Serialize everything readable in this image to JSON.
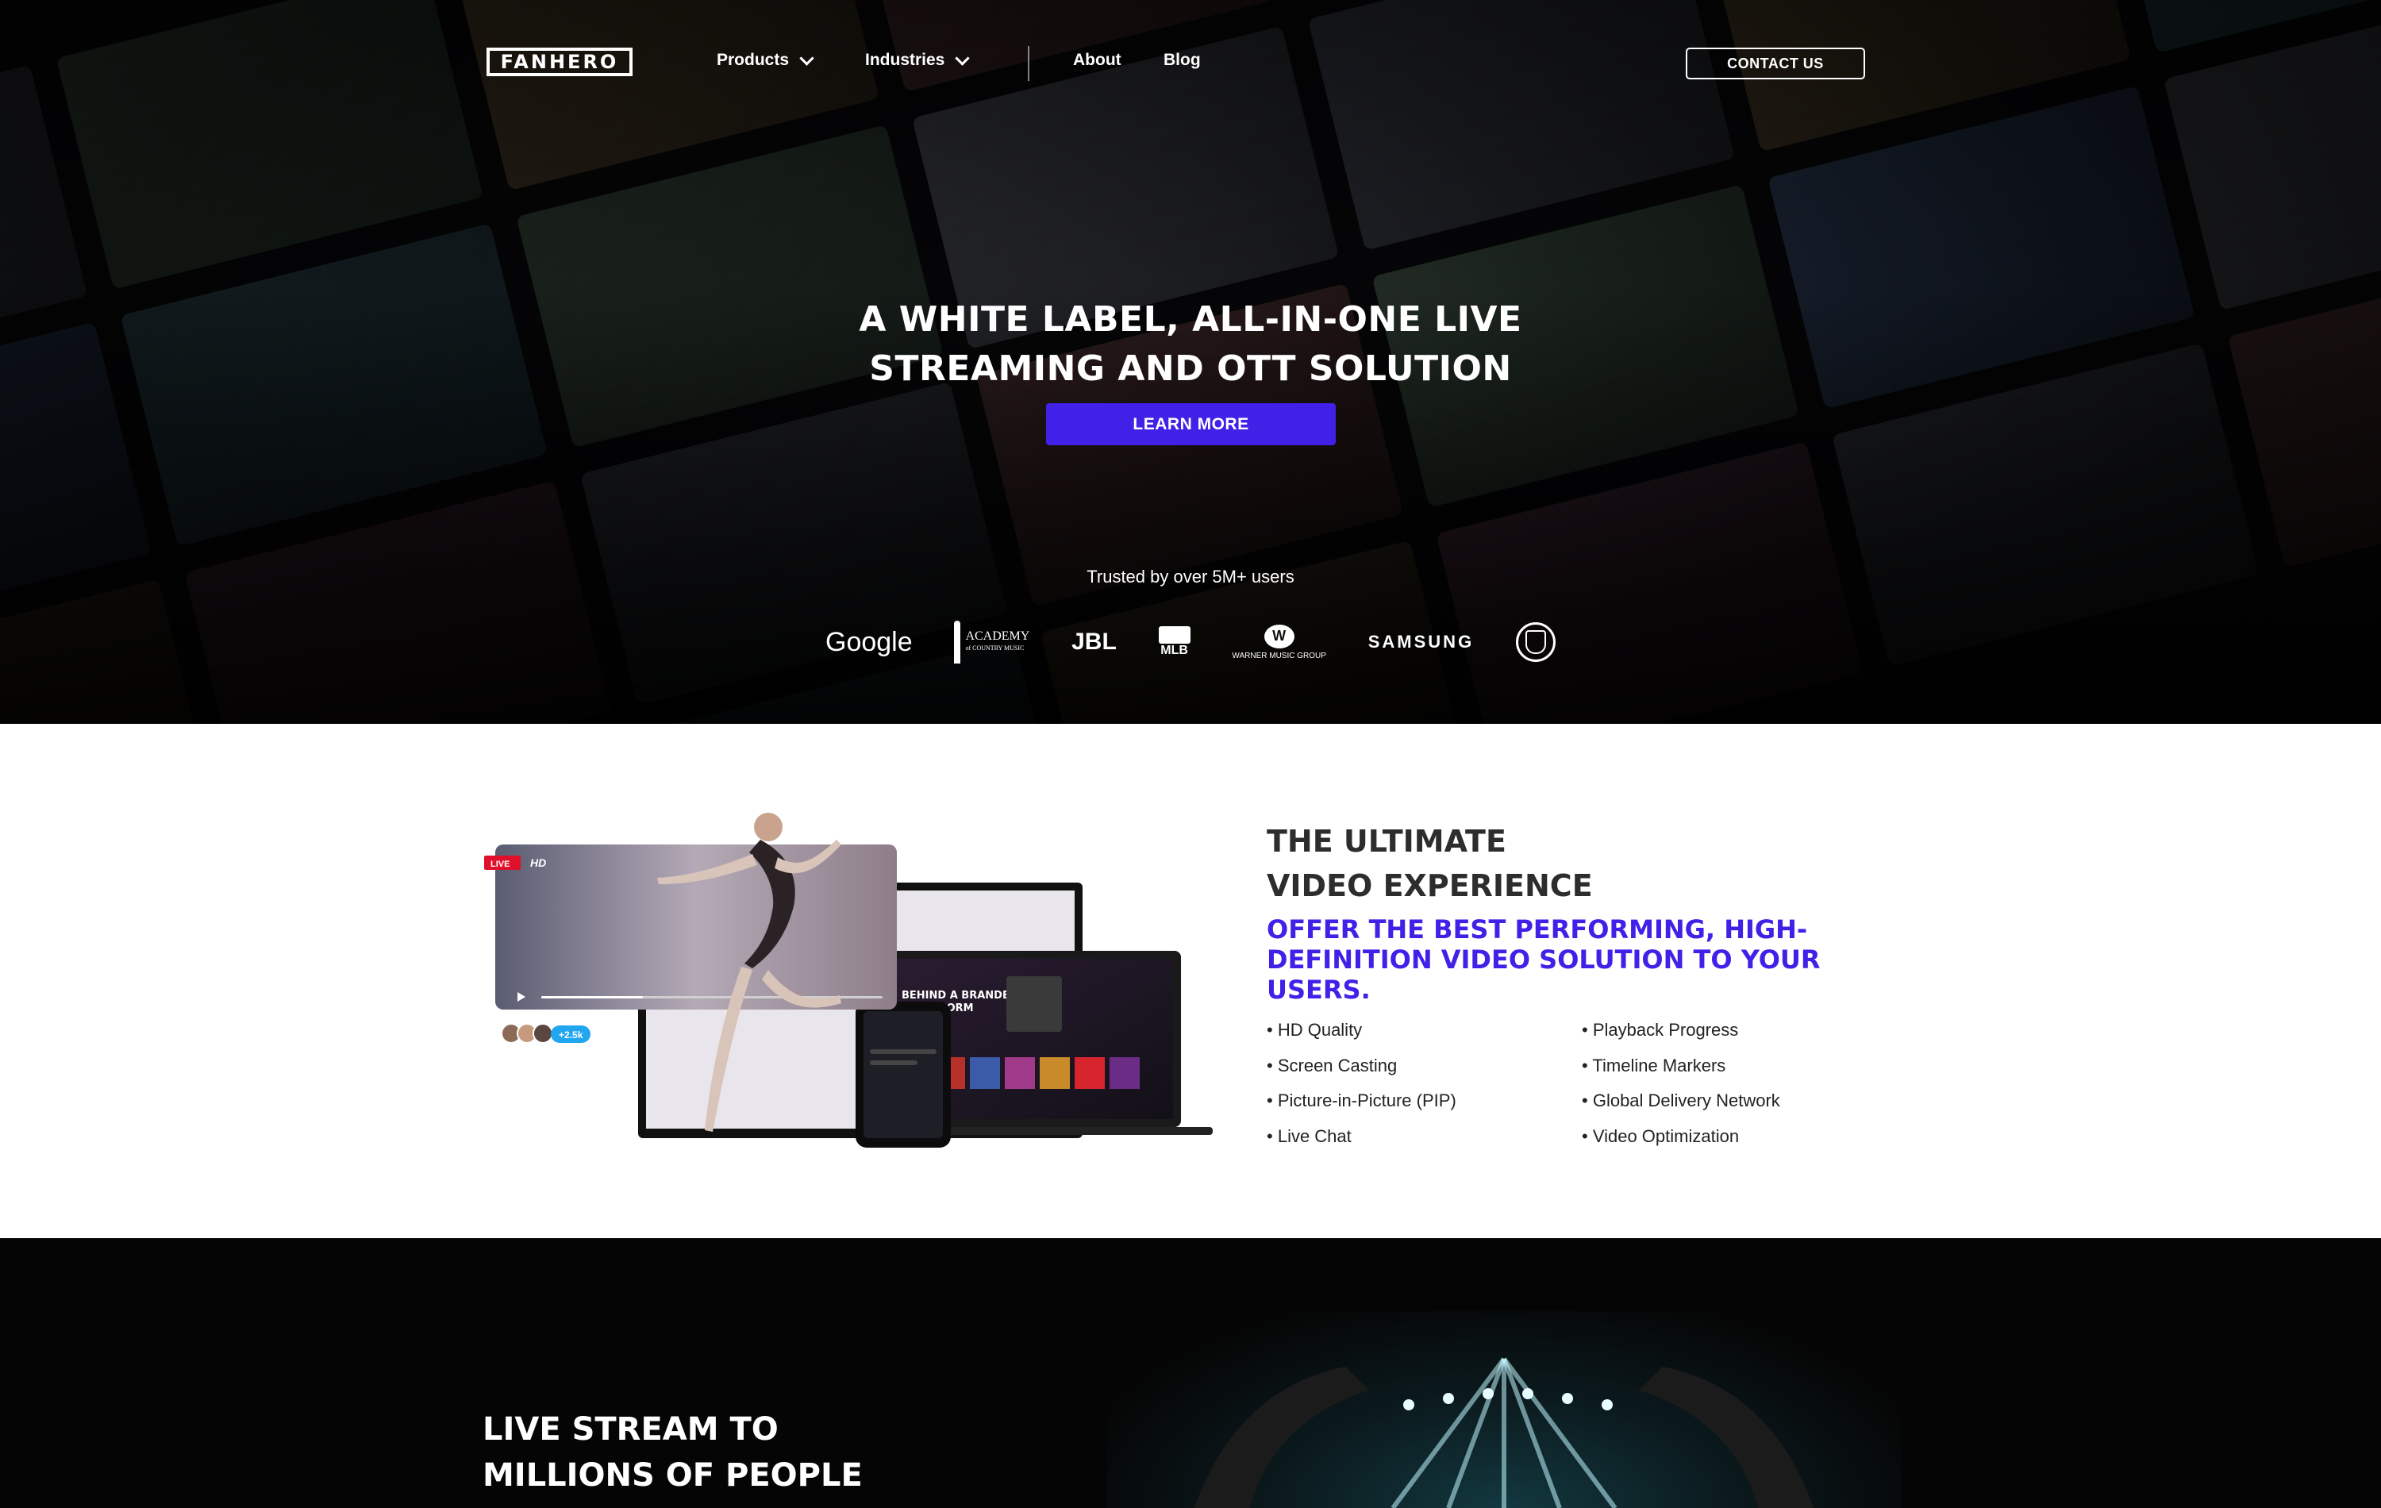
{
  "nav": {
    "logo": "FANHERO",
    "products": "Products",
    "industries": "Industries",
    "about": "About",
    "blog": "Blog",
    "contact": "CONTACT US"
  },
  "hero": {
    "title_line1": "A WHITE LABEL, ALL-IN-ONE LIVE",
    "title_line2": "STREAMING AND OTT SOLUTION",
    "cta": "LEARN MORE",
    "trusted": "Trusted by over 5M+ users",
    "logos": {
      "google": "Google",
      "academy": "ACADEMY",
      "academy_sub": "of COUNTRY MUSIC",
      "jbl": "JBL",
      "mlb": "MLB",
      "wmg": "WARNER MUSIC GROUP",
      "samsung": "SAMSUNG"
    }
  },
  "feature": {
    "title_line1": "THE ULTIMATE",
    "title_line2": "VIDEO EXPERIENCE",
    "subtitle": "OFFER THE BEST PERFORMING, HIGH-DEFINITION VIDEO SOLUTION TO YOUR USERS.",
    "list_left": [
      "HD Quality",
      "Screen Casting",
      "Picture-in-Picture (PIP)",
      "Live Chat"
    ],
    "list_right": [
      "Playback Progress",
      "Timeline Markers",
      "Global Delivery Network",
      "Video Optimization"
    ],
    "mockup": {
      "live_badge": "LIVE",
      "hd_badge": "HD",
      "viewers": "+2.5k",
      "laptop_text_line1": "BEHIND A BRANDED",
      "laptop_text_line2": "PLATFORM"
    }
  },
  "live": {
    "title_line1": "LIVE STREAM TO",
    "title_line2": "MILLIONS OF PEOPLE"
  },
  "colors": {
    "accent": "#4120e8",
    "hero_bg": "#07070a",
    "live_badge": "#e0102a",
    "viewer_pill": "#23a6f0"
  }
}
